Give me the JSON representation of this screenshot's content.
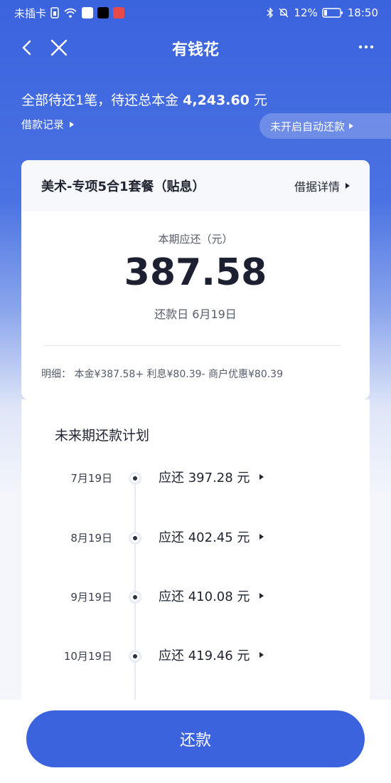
{
  "status_bar": {
    "carrier": "未插卡",
    "battery": "12%",
    "time": "18:50"
  },
  "nav": {
    "title": "有钱花"
  },
  "summary": {
    "prefix": "全部待还1笔，待还总本金",
    "amount": "4,243.60",
    "unit": "元",
    "records_label": "借款记录",
    "autopay_label": "未开启自动还款"
  },
  "loan_card": {
    "title": "美术-专项5合1套餐（贴息）",
    "detail_link": "借据详情",
    "due_label": "本期应还（元）",
    "due_amount": "387.58",
    "due_date_label": "还款日 6月19日",
    "breakdown": "明细：  本金¥387.58+ 利息¥80.39- 商户优惠¥80.39"
  },
  "plan": {
    "title": "未来期还款计划",
    "items": [
      {
        "date": "7月19日",
        "amount": "应还 397.28 元"
      },
      {
        "date": "8月19日",
        "amount": "应还 402.45 元"
      },
      {
        "date": "9月19日",
        "amount": "应还 410.08 元"
      },
      {
        "date": "10月19日",
        "amount": "应还 419.46 元"
      }
    ]
  },
  "pay_button": {
    "label": "还款"
  },
  "colors": {
    "brand": "#3b63de",
    "text_dark": "#1f2430"
  }
}
